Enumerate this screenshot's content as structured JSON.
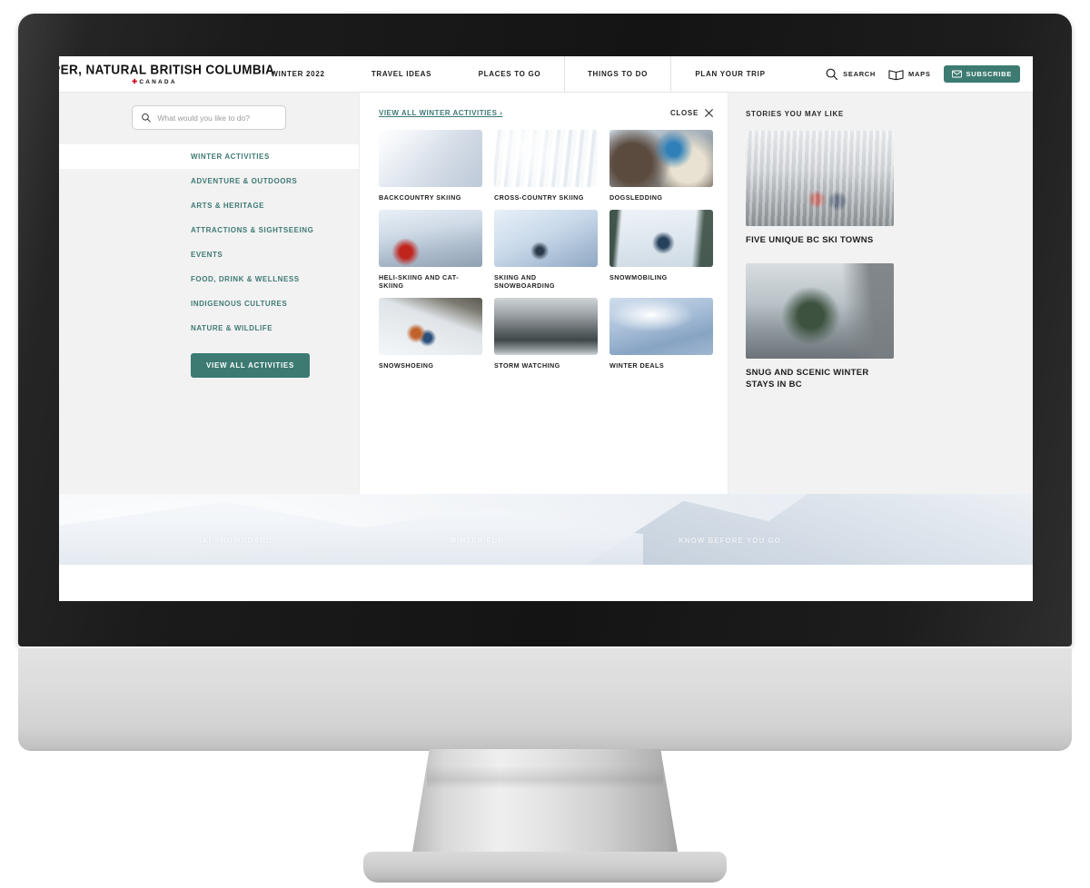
{
  "header": {
    "logo_main": "SUPER, NATURAL BRITISH COLUMBIA",
    "logo_sub": "CANADA",
    "nav_tabs": [
      {
        "label": "WINTER 2022",
        "active": false
      },
      {
        "label": "TRAVEL IDEAS",
        "active": false
      },
      {
        "label": "PLACES TO GO",
        "active": false
      },
      {
        "label": "THINGS TO DO",
        "active": true
      },
      {
        "label": "PLAN YOUR TRIP",
        "active": false
      }
    ],
    "utils": [
      {
        "label": "SEARCH",
        "icon": "search-icon"
      },
      {
        "label": "MAPS",
        "icon": "map-icon"
      }
    ],
    "subscribe_label": "SUBSCRIBE",
    "subscribe_icon": "envelope-icon",
    "subscribe_color": "#3c7a72"
  },
  "mega_menu": {
    "search": {
      "placeholder": "What would you like to do?",
      "value": "",
      "icon": "search-icon"
    },
    "categories": [
      {
        "label": "WINTER ACTIVITIES",
        "active": true
      },
      {
        "label": "ADVENTURE & OUTDOORS",
        "active": false
      },
      {
        "label": "ARTS & HERITAGE",
        "active": false
      },
      {
        "label": "ATTRACTIONS & SIGHTSEEING",
        "active": false
      },
      {
        "label": "EVENTS",
        "active": false
      },
      {
        "label": "FOOD, DRINK & WELLNESS",
        "active": false
      },
      {
        "label": "INDIGENOUS CULTURES",
        "active": false
      },
      {
        "label": "NATURE & WILDLIFE",
        "active": false
      }
    ],
    "view_all_activities_label": "VIEW ALL ACTIVITIES",
    "center": {
      "view_all_link": "VIEW ALL WINTER ACTIVITIES ›",
      "close_label": "CLOSE",
      "close_icon": "close-icon",
      "tiles": [
        {
          "label": "BACKCOUNTRY SKIING",
          "photo": "ph-backcountry"
        },
        {
          "label": "CROSS-COUNTRY SKIING",
          "photo": "ph-crosscountry"
        },
        {
          "label": "DOGSLEDDING",
          "photo": "ph-dogsled"
        },
        {
          "label": "HELI-SKIING AND CAT-SKIING",
          "photo": "ph-heli"
        },
        {
          "label": "SKIING AND SNOWBOARDING",
          "photo": "ph-ski"
        },
        {
          "label": "SNOWMOBILING",
          "photo": "ph-snowmobile"
        },
        {
          "label": "SNOWSHOEING",
          "photo": "ph-snowshoe"
        },
        {
          "label": "STORM WATCHING",
          "photo": "ph-storm"
        },
        {
          "label": "WINTER DEALS",
          "photo": "ph-deals"
        }
      ]
    },
    "stories": {
      "heading": "STORIES YOU MAY LIKE",
      "items": [
        {
          "title": "FIVE UNIQUE BC SKI TOWNS",
          "photo": "ph-skitowns"
        },
        {
          "title": "SNUG AND SCENIC WINTER STAYS IN BC",
          "photo": "ph-stays"
        }
      ]
    }
  },
  "hero": {
    "nav_items": [
      {
        "label": "SKI/SNOWBOARD"
      },
      {
        "label": "WINTER FUN"
      },
      {
        "label": "KNOW BEFORE YOU GO"
      }
    ]
  },
  "colors": {
    "teal": "#3c7a72",
    "link_teal": "#3f7a74",
    "sidebar_bg": "#f2f2f2",
    "text_dark": "#1d1d1d"
  }
}
